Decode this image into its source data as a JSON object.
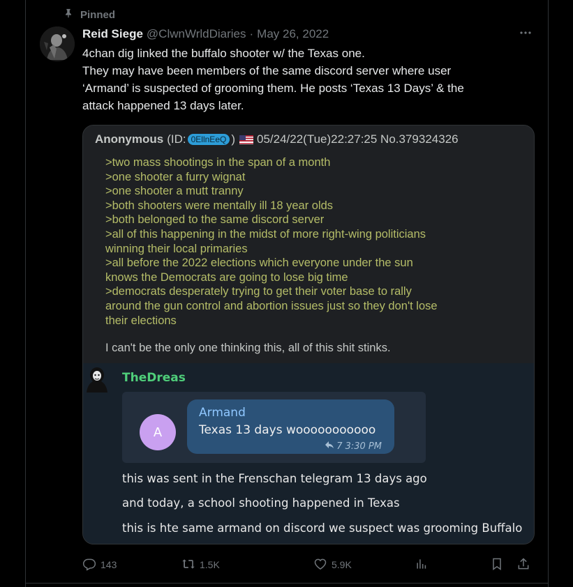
{
  "pinned": {
    "label": "Pinned",
    "icon": "pin-icon"
  },
  "tweet": {
    "author_name": "Reid Siege",
    "handle": "@ClwnWrldDiaries",
    "separator": "·",
    "date": "May 26, 2022",
    "lines": [
      "4chan dig linked the buffalo shooter w/ the Texas one.",
      "They may have been members of the same discord server where user",
      "‘Armand’ is suspected of grooming them. He posts ‘Texas 13 Days’ & the",
      "attack happened 13 days later."
    ]
  },
  "image": {
    "chan_post": {
      "name": "Anonymous",
      "id_prefix": "(ID: ",
      "poster_id": "0EllnEeQ",
      "id_suffix": ")",
      "timestamp": "05/24/22(Tue)22:27:25 No.379324326",
      "greentext": [
        ">two mass shootings in the span of a month",
        ">one shooter a furry wignat",
        ">one shooter a mutt tranny",
        ">both shooters were mentally ill 18 year olds",
        ">both belonged to the same discord server",
        ">all of this happening in the midst of more right-wing politicians",
        "winning their local primaries",
        ">all before the 2022 elections which everyone under the sun",
        "knows the Democrats are going to lose big time",
        ">democrats desperately trying to get their voter base to rally",
        "around the gun control and abortion issues just so they don't lose",
        "their elections"
      ],
      "closing": "I can't be the only one thinking this, all of this shit stinks."
    },
    "telegram": {
      "username": "TheDreas",
      "forward_avatar_letter": "A",
      "forward_sender": "Armand",
      "forward_message": "Texas 13 days wooooooooooo",
      "forward_time": "7 3:30 PM",
      "messages": [
        "this was sent in the Frenschan telegram 13 days ago",
        "and today, a school shooting happened in Texas",
        "this is hte same armand on discord we suspect was grooming Buffalo"
      ]
    }
  },
  "actions": {
    "replies": "143",
    "reposts": "1.5K",
    "likes": "5.9K"
  },
  "colors": {
    "background": "#000000",
    "text": "#e7e9ea",
    "muted": "#71767b",
    "greentext": "#b5bd68",
    "telegram_username": "#4fce7a",
    "telegram_bubble": "#2b5278"
  }
}
